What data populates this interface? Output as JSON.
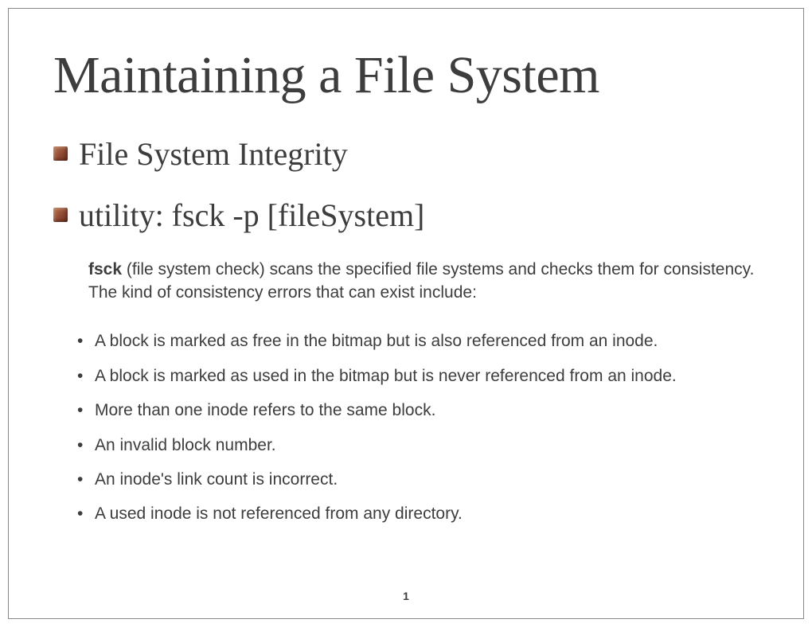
{
  "title": "Maintaining a File System",
  "bullets": [
    "File System Integrity",
    "utility:  fsck  -p  [fileSystem]"
  ],
  "description_bold": "fsck",
  "description_rest": " (file system check) scans the specified file systems and checks them for consistency. The kind of consistency errors that can exist include:",
  "list_items": [
    "A block is marked as free in the bitmap but is also referenced from an inode.",
    "A block is marked as used in the bitmap but is never referenced from an inode.",
    "More than one inode refers to the same block.",
    "An invalid block number.",
    "An inode's link count is incorrect.",
    "A used inode is not referenced from any directory."
  ],
  "page_number": "1"
}
